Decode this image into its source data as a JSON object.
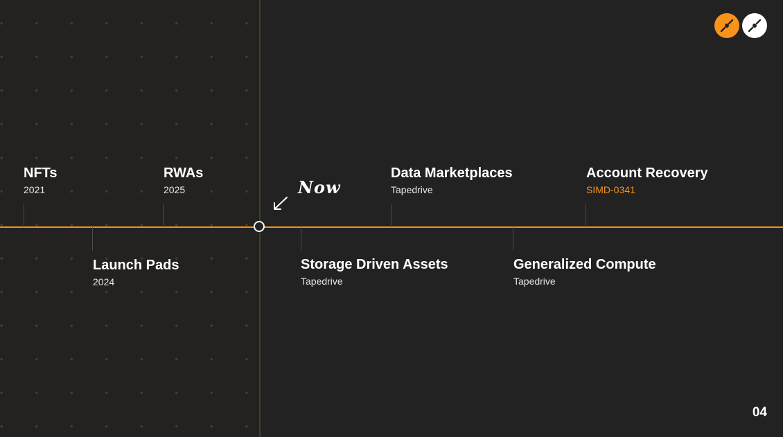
{
  "now_label": "Now",
  "accent_color": "#f7931a",
  "page_number": "04",
  "events": [
    {
      "title": "NFTs",
      "subtitle": "2021"
    },
    {
      "title": "Launch Pads",
      "subtitle": "2024"
    },
    {
      "title": "RWAs",
      "subtitle": "2025"
    },
    {
      "title": "Storage Driven Assets",
      "subtitle": "Tapedrive"
    },
    {
      "title": "Data Marketplaces",
      "subtitle": "Tapedrive"
    },
    {
      "title": "Generalized Compute",
      "subtitle": "Tapedrive"
    },
    {
      "title": "Account Recovery",
      "subtitle": "SIMD-0341"
    }
  ],
  "logos": [
    "disc-icon-orange",
    "disc-icon-white"
  ]
}
